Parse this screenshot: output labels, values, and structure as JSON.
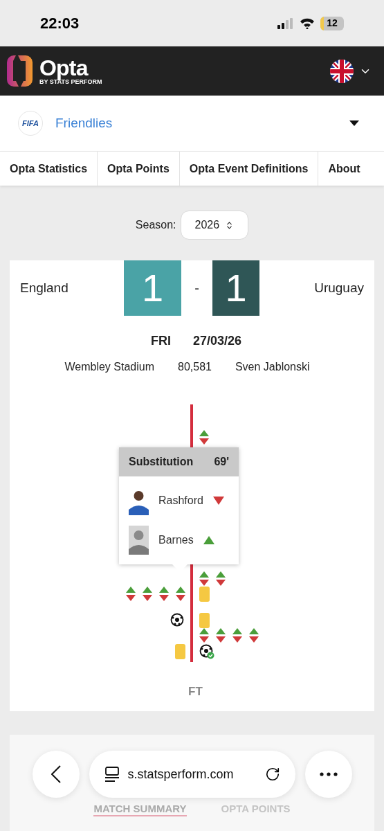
{
  "status_bar": {
    "time": "22:03",
    "battery": "12"
  },
  "header": {
    "logo": "Opta",
    "logo_sub": "BY STATS PERFORM"
  },
  "competition": {
    "badge": "FIFA",
    "name": "Friendlies"
  },
  "nav": [
    {
      "label": "Opta Statistics"
    },
    {
      "label": "Opta Points"
    },
    {
      "label": "Opta Event Definitions"
    },
    {
      "label": "About"
    }
  ],
  "season": {
    "label": "Season:",
    "value": "2026"
  },
  "match": {
    "home": "England",
    "away": "Uruguay",
    "home_score": "1",
    "separator": "-",
    "away_score": "1",
    "day": "FRI",
    "date": "27/03/26",
    "venue": "Wembley Stadium",
    "attendance": "80,581",
    "referee": "Sven Jablonski"
  },
  "timeline": {
    "rows": [
      {
        "home": [],
        "away": [
          {
            "kind": "sub"
          }
        ]
      },
      {
        "home": [],
        "away": [
          {
            "kind": "sub"
          },
          {
            "kind": "sub"
          }
        ]
      },
      {
        "home": [
          {
            "kind": "sub"
          },
          {
            "kind": "sub"
          },
          {
            "kind": "sub"
          },
          {
            "kind": "sub"
          }
        ],
        "away": [
          {
            "kind": "yellow"
          }
        ]
      },
      {
        "home": [
          {
            "kind": "goal"
          }
        ],
        "away": [
          {
            "kind": "yellow"
          }
        ]
      },
      {
        "home": [],
        "away": [
          {
            "kind": "sub"
          },
          {
            "kind": "sub"
          },
          {
            "kind": "sub"
          },
          {
            "kind": "sub"
          }
        ]
      },
      {
        "home": [
          {
            "kind": "yellow"
          }
        ],
        "away": [
          {
            "kind": "goal_confirmed"
          }
        ]
      }
    ],
    "end": "FT"
  },
  "tooltip": {
    "title": "Substitution",
    "minute": "69'",
    "players": [
      {
        "name": "Rashford",
        "kind": "off"
      },
      {
        "name": "Barnes",
        "kind": "on"
      }
    ]
  },
  "lower_tabs": [
    {
      "label": "MATCH SUMMARY",
      "selected": true
    },
    {
      "label": "OPTA POINTS",
      "selected": false
    }
  ],
  "browser": {
    "url": "s.statsperform.com"
  }
}
